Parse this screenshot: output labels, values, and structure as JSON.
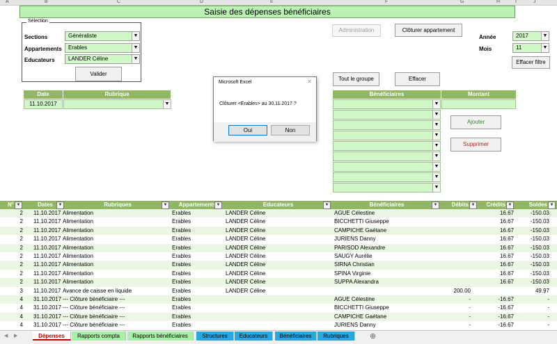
{
  "app": {
    "title": "Saisie des dépenses bénéficiaires"
  },
  "column_letters": [
    "A",
    "B",
    "C",
    "D",
    "E",
    "F",
    "G",
    "H",
    "I",
    "J"
  ],
  "selection": {
    "legend": "Sélection",
    "sections_label": "Sections",
    "sections_value": "Généraliste",
    "apartments_label": "Appartements",
    "apartments_value": "Erables",
    "educators_label": "Educateurs",
    "educators_value": "LANDER Céline",
    "validate_button": "Valider"
  },
  "top_buttons": {
    "administration": "Administration",
    "close_apartment": "Clôturer appartement",
    "all_group": "Tout le groupe",
    "clear": "Effacer",
    "clear_filter": "Effacer filtre",
    "add": "Ajouter",
    "delete": "Supprimer"
  },
  "period": {
    "year_label": "Année",
    "year_value": "2017",
    "month_label": "Mois",
    "month_value": "11"
  },
  "entry": {
    "date_header": "Date",
    "date_value": "11.10.2017",
    "category_header": "Rubrique",
    "beneficiaries_header": "Bénéficiaires",
    "amount_header": "Montant"
  },
  "dialog": {
    "title": "Microsoft Excel",
    "close": "✕",
    "message": "Clôturer <Erables> au 30.11.2017 ?",
    "yes": "Oui",
    "no": "Non"
  },
  "table": {
    "headers": [
      "N°",
      "Dates",
      "Rubriques",
      "Appartements",
      "Educateurs",
      "Bénéficiaires",
      "Débits",
      "Crédits",
      "Soldes"
    ],
    "rows": [
      [
        "2",
        "11.10.2017",
        "Alimentation",
        "Erables",
        "LANDER Céline",
        "AGUE Célestine",
        "",
        "16.67",
        "-150.03"
      ],
      [
        "2",
        "11.10.2017",
        "Alimentation",
        "Erables",
        "LANDER Céline",
        "BICCHETTI Giuseppe",
        "",
        "16.67",
        "-150.03"
      ],
      [
        "2",
        "11.10.2017",
        "Alimentation",
        "Erables",
        "LANDER Céline",
        "CAMPICHE Gaétane",
        "",
        "16.67",
        "-150.03"
      ],
      [
        "2",
        "11.10.2017",
        "Alimentation",
        "Erables",
        "LANDER Céline",
        "JURIENS Danny",
        "",
        "16.67",
        "-150.03"
      ],
      [
        "2",
        "11.10.2017",
        "Alimentation",
        "Erables",
        "LANDER Céline",
        "PARISOD Alexandre",
        "",
        "16.67",
        "-150.03"
      ],
      [
        "2",
        "11.10.2017",
        "Alimentation",
        "Erables",
        "LANDER Céline",
        "SAUGY Aurélie",
        "",
        "16.67",
        "-150.03"
      ],
      [
        "2",
        "11.10.2017",
        "Alimentation",
        "Erables",
        "LANDER Céline",
        "SIRNA Christian",
        "",
        "16.67",
        "-150.03"
      ],
      [
        "2",
        "11.10.2017",
        "Alimentation",
        "Erables",
        "LANDER Céline",
        "SPINA Virginie",
        "",
        "16.67",
        "-150.03"
      ],
      [
        "2",
        "11.10.2017",
        "Alimentation",
        "Erables",
        "LANDER Céline",
        "SUPPA Alexandra",
        "",
        "16.67",
        "-150.03"
      ],
      [
        "3",
        "11.10.2017",
        "Avance de caisse en liquide",
        "Erables",
        "LANDER Céline",
        "",
        "200.00",
        "",
        "49.97"
      ],
      [
        "4",
        "31.10.2017",
        "--- Clôture bénéficiaire ---",
        "Erables",
        "",
        "AGUE Célestine",
        "-",
        "-16.67",
        "-"
      ],
      [
        "4",
        "31.10.2017",
        "--- Clôture bénéficiaire ---",
        "Erables",
        "",
        "BICCHETTI Giuseppe",
        "-",
        "-16.67",
        "-"
      ],
      [
        "4",
        "31.10.2017",
        "--- Clôture bénéficiaire ---",
        "Erables",
        "",
        "CAMPICHE Gaétane",
        "-",
        "-16.67",
        "-"
      ],
      [
        "4",
        "31.10.2017",
        "--- Clôture bénéficiaire ---",
        "Erables",
        "",
        "JURIENS Danny",
        "-",
        "-16.67",
        "-"
      ]
    ]
  },
  "sheet_tabs": [
    {
      "label": "Dépenses",
      "color": "#ffffff",
      "text": "#c00000"
    },
    {
      "label": "Rapports compta",
      "color": "#a8efa8",
      "text": "#000000"
    },
    {
      "label": "Rapports bénéficiaires",
      "color": "#a8efa8",
      "text": "#000000"
    },
    {
      "label": "Structures",
      "color": "#2aa7e0",
      "text": "#000000"
    },
    {
      "label": "Educateurs",
      "color": "#2aa7e0",
      "text": "#000000"
    },
    {
      "label": "Bénéficiaires",
      "color": "#2aa7e0",
      "text": "#000000"
    },
    {
      "label": "Rubriques",
      "color": "#2aa7e0",
      "text": "#000000"
    }
  ],
  "add_sheet": "⊕",
  "scroll_arrows": {
    "left": "◀",
    "right": "▶"
  },
  "dropdown_glyph": "▼"
}
